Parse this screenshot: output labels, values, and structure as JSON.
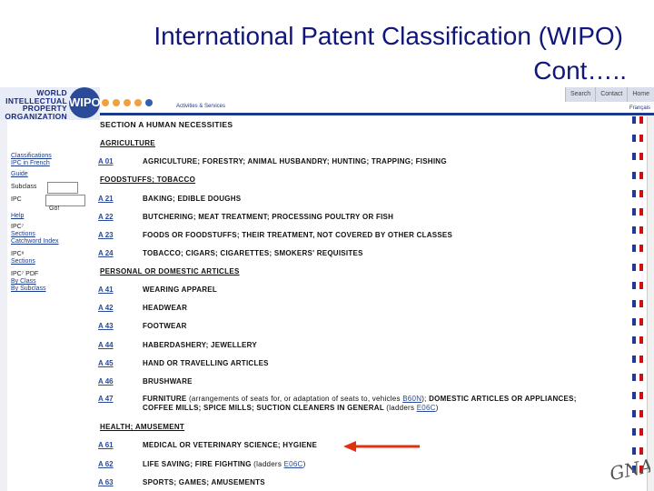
{
  "slide": {
    "title_line1": "International Patent Classification (WIPO)",
    "title_line2": "Cont….."
  },
  "header": {
    "logo_text": "WORLD INTELLECTUAL PROPERTY ORGANIZATION",
    "logo_mark": "WIPO",
    "activities": "Activities & Services",
    "nav": [
      "Search",
      "Contact",
      "Home"
    ],
    "language": "Français"
  },
  "sidebar": {
    "classifications": "Classifications",
    "ipc_in_french": "IPC in French",
    "guide": "Guide",
    "subclass_label": "Subclass",
    "ipc_label": "IPC",
    "go": "Go!",
    "help": "Help",
    "ipc7_a": "IPC⁷",
    "sections": "Sections",
    "catchword": "Catchword Index",
    "ipc8": "IPC⁸",
    "sections2": "Sections",
    "ipc7_pdf": "IPC⁷ PDF",
    "by_class": "By Class",
    "by_subclass": "By Subclass"
  },
  "content": {
    "section": "SECTION A   HUMAN NECESSITIES",
    "groups": [
      {
        "heading": "AGRICULTURE",
        "rows": [
          {
            "code": "A 01",
            "desc": "AGRICULTURE; FORESTRY; ANIMAL HUSBANDRY; HUNTING; TRAPPING; FISHING"
          }
        ]
      },
      {
        "heading": "FOODSTUFFS; TOBACCO",
        "rows": [
          {
            "code": "A 21",
            "desc": "BAKING; EDIBLE DOUGHS"
          },
          {
            "code": "A 22",
            "desc": "BUTCHERING; MEAT TREATMENT; PROCESSING POULTRY OR FISH"
          },
          {
            "code": "A 23",
            "desc": "FOODS OR FOODSTUFFS; THEIR TREATMENT, NOT COVERED BY OTHER CLASSES"
          },
          {
            "code": "A 24",
            "desc": "TOBACCO; CIGARS; CIGARETTES; SMOKERS' REQUISITES"
          }
        ]
      },
      {
        "heading": "PERSONAL OR DOMESTIC ARTICLES",
        "rows": [
          {
            "code": "A 41",
            "desc": "WEARING APPAREL"
          },
          {
            "code": "A 42",
            "desc": "HEADWEAR"
          },
          {
            "code": "A 43",
            "desc": "FOOTWEAR"
          },
          {
            "code": "A 44",
            "desc": "HABERDASHERY; JEWELLERY"
          },
          {
            "code": "A 45",
            "desc": "HAND OR TRAVELLING ARTICLES"
          },
          {
            "code": "A 46",
            "desc": "BRUSHWARE"
          }
        ]
      },
      {
        "heading": "HEALTH; AMUSEMENT",
        "rows": [
          {
            "code": "A 61",
            "desc": "MEDICAL OR VETERINARY SCIENCE; HYGIENE"
          },
          {
            "code": "A 63",
            "desc": "SPORTS; GAMES; AMUSEMENTS"
          }
        ]
      }
    ],
    "a47": {
      "code": "A 47",
      "main": "FURNITURE",
      "paren_a": "(arrangements of seats for, or adaptation of seats to, vehicles",
      "link_a": "B60N",
      "paren_a_end": ");",
      "rest": "DOMESTIC ARTICLES OR APPLIANCES; COFFEE MILLS; SPICE MILLS; SUCTION CLEANERS IN GENERAL",
      "ladders": "(ladders",
      "link_b": "E06C",
      "end": ")"
    },
    "a62": {
      "code": "A 62",
      "desc": "LIFE SAVING; FIRE FIGHTING",
      "ladders": "(ladders",
      "link": "E06C",
      "end": ")"
    }
  },
  "watermark": "GNAS",
  "colors": {
    "title": "#10167a",
    "link": "#2a4a9a",
    "arrow": "#e03010"
  }
}
